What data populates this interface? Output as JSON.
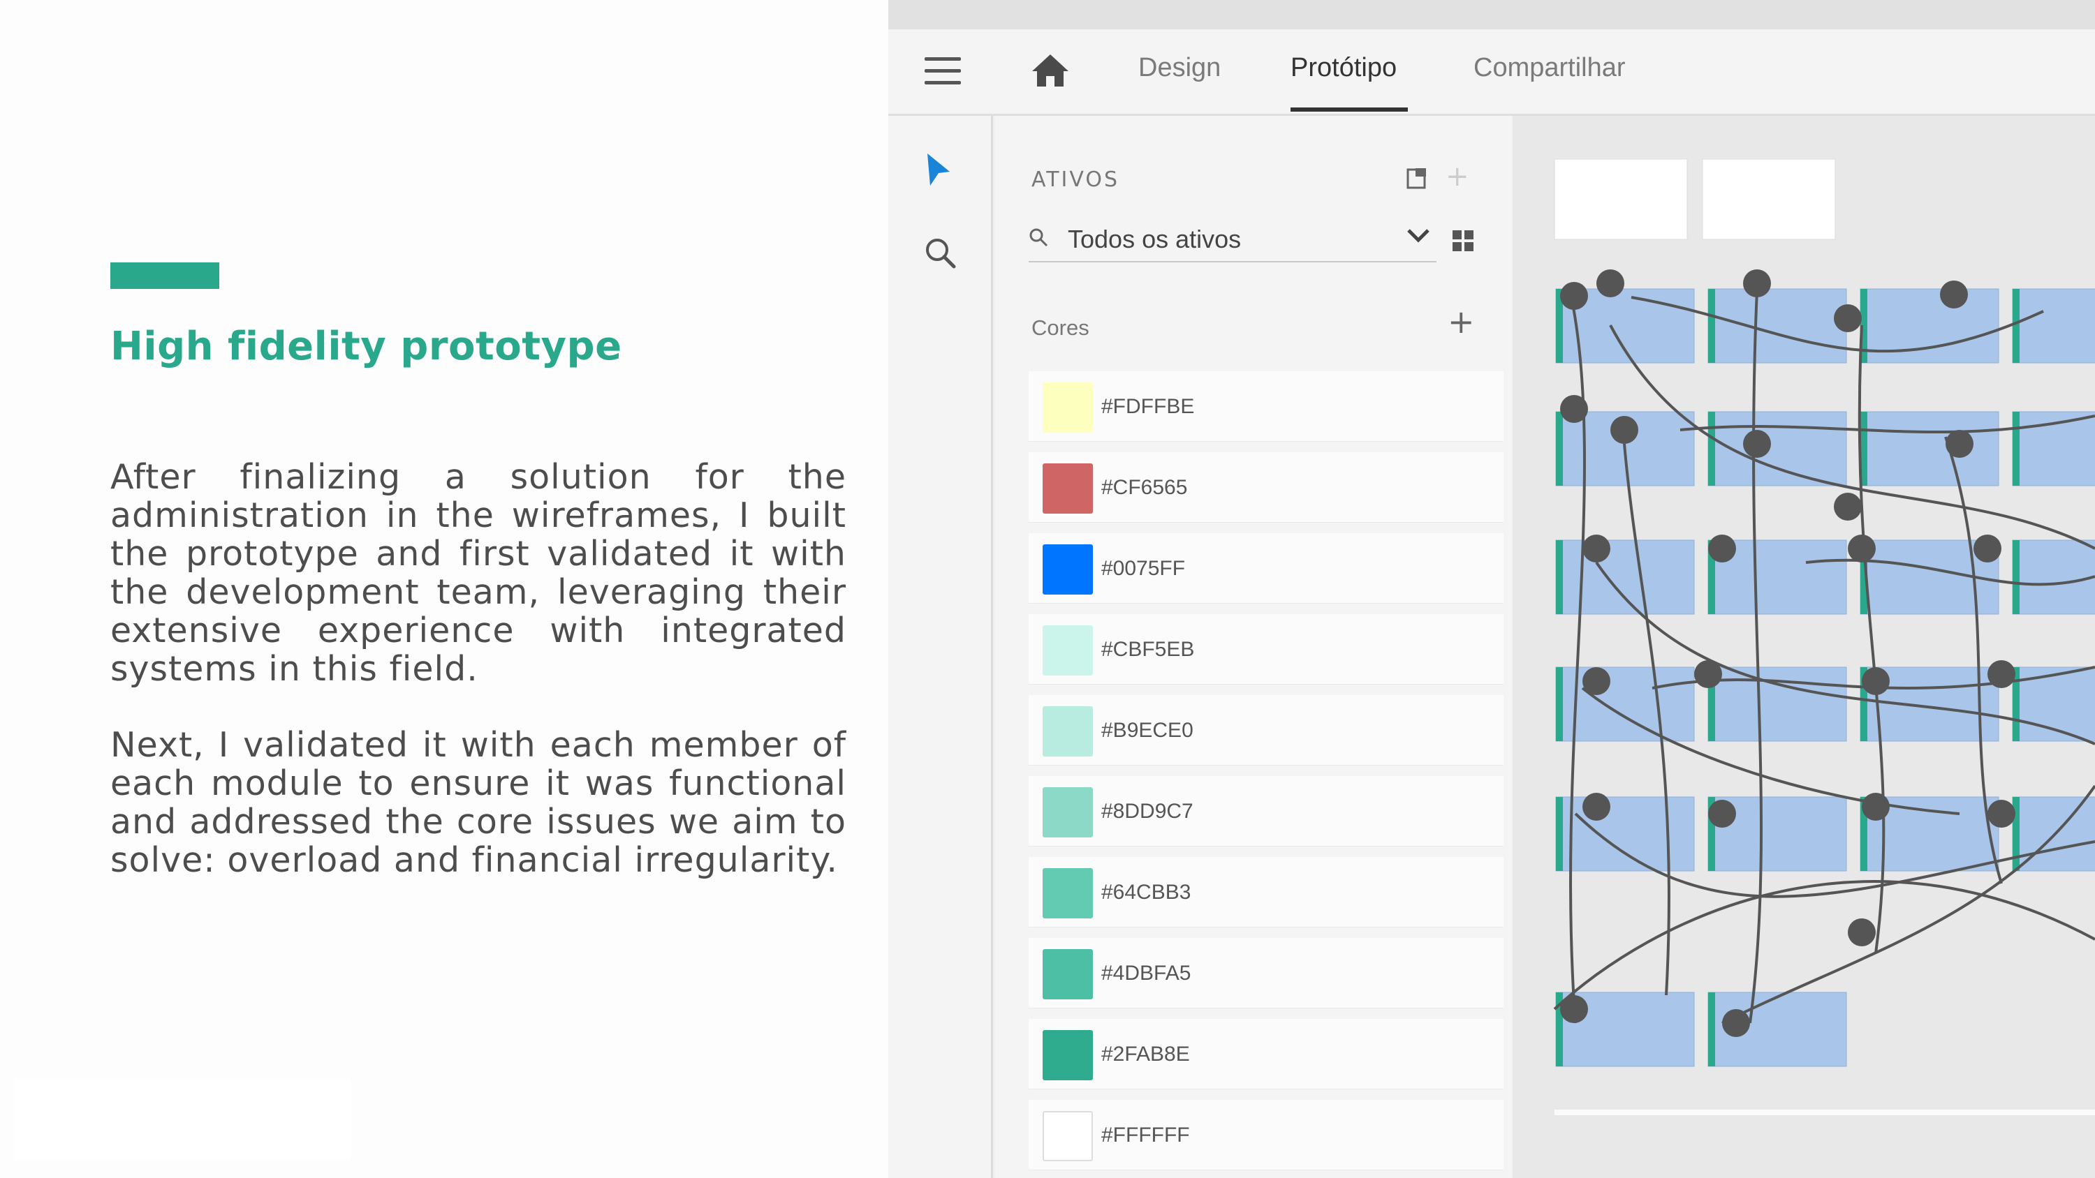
{
  "slide": {
    "heading": "High fidelity prototype",
    "paragraph_1": "After finalizing a solution for the administration in the wireframes, I built the prototype and first validated it with the development team, leveraging their extensive experience with integrated systems in this field.",
    "paragraph_2": "Next, I validated it with each member of each module to ensure it was functional and addressed the core issues we aim to solve: overload and financial irregularity.",
    "accent_color": "#2aa88b"
  },
  "app": {
    "tabs": [
      {
        "label": "Design"
      },
      {
        "label": "Protótipo",
        "active": true
      },
      {
        "label": "Compartilhar"
      }
    ],
    "icons": {
      "menu": "hamburger-icon",
      "home": "home-icon",
      "select": "select-arrow-icon",
      "search": "search-icon"
    }
  },
  "assets": {
    "title": "ATIVOS",
    "filter": "Todos os ativos",
    "colors_label": "Cores",
    "colors": [
      {
        "hex": "#FDFFBE",
        "label": "#FDFFBE"
      },
      {
        "hex": "#CF6565",
        "label": "#CF6565"
      },
      {
        "hex": "#0075FF",
        "label": "#0075FF"
      },
      {
        "hex": "#CBF5EB",
        "label": "#CBF5EB"
      },
      {
        "hex": "#B9ECE0",
        "label": "#B9ECE0"
      },
      {
        "hex": "#8DD9C7",
        "label": "#8DD9C7"
      },
      {
        "hex": "#64CBB3",
        "label": "#64CBB3"
      },
      {
        "hex": "#4DBFA5",
        "label": "#4DBFA5"
      },
      {
        "hex": "#2FAB8E",
        "label": "#2FAB8E"
      },
      {
        "hex": "#FFFFFF",
        "label": "#FFFFFF"
      }
    ]
  }
}
